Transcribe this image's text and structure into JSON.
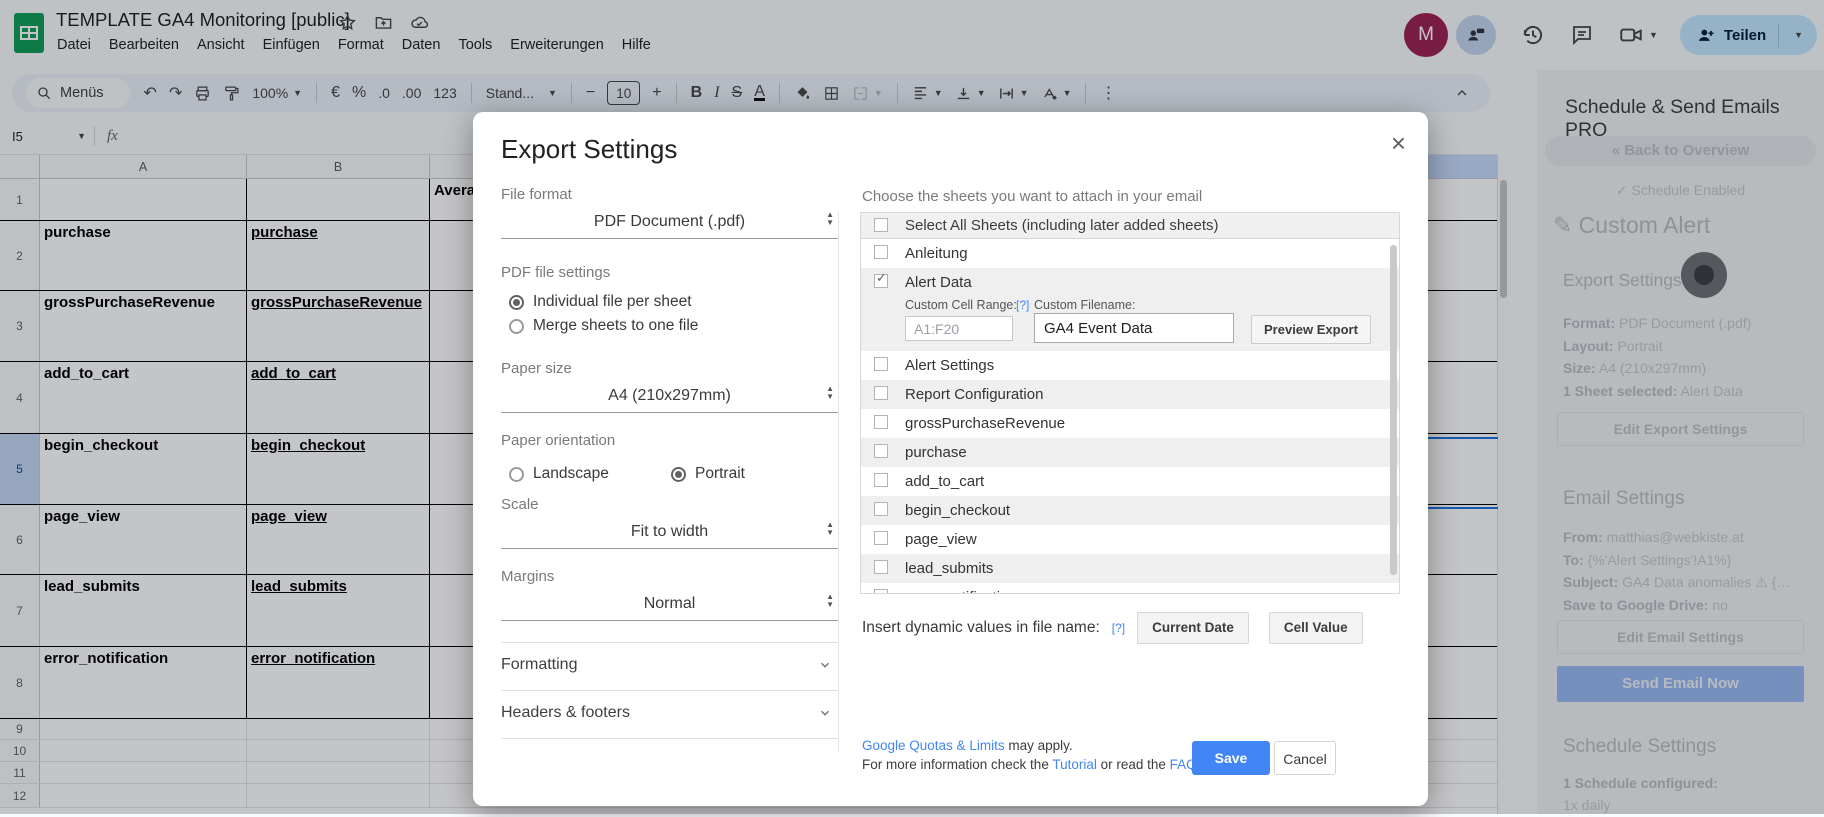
{
  "titlebar": {
    "doc_title": "TEMPLATE GA4 Monitoring [public]",
    "menus": [
      "Datei",
      "Bearbeiten",
      "Ansicht",
      "Einfügen",
      "Format",
      "Daten",
      "Tools",
      "Erweiterungen",
      "Hilfe"
    ],
    "avatar_letter": "M",
    "share_label": "Teilen"
  },
  "toolbar": {
    "menus_label": "Menüs",
    "undo": "↶",
    "redo": "↷",
    "zoom": "100%",
    "currency": "€",
    "percent": "%",
    "dec0": ".0",
    "dec00": ".00",
    "fmt123": "123",
    "font_name": "Stand...",
    "minus": "−",
    "font_size": "10",
    "plus": "+",
    "bold": "B",
    "italic": "I",
    "strike": "S",
    "text_color": "A",
    "more": "⋮"
  },
  "formula_bar": {
    "cell_ref": "I5",
    "fx": "fx"
  },
  "grid": {
    "col_headers": [
      "A",
      "B"
    ],
    "rows": [
      {
        "n": "1",
        "a": "",
        "b": "",
        "c": "Avera"
      },
      {
        "n": "2",
        "a": "purchase",
        "b": "purchase"
      },
      {
        "n": "3",
        "a": "grossPurchaseRevenue",
        "b": "grossPurchaseRevenue"
      },
      {
        "n": "4",
        "a": "add_to_cart",
        "b": "add_to_cart"
      },
      {
        "n": "5",
        "a": "begin_checkout",
        "b": "begin_checkout"
      },
      {
        "n": "6",
        "a": "page_view",
        "b": "page_view"
      },
      {
        "n": "7",
        "a": "lead_submits",
        "b": "lead_submits"
      },
      {
        "n": "8",
        "a": "error_notification",
        "b": "error_notification"
      },
      {
        "n": "9"
      },
      {
        "n": "10"
      },
      {
        "n": "11"
      },
      {
        "n": "12"
      }
    ],
    "selection_color": "#1a73e8"
  },
  "modal": {
    "title": "Export Settings",
    "close": "×",
    "file_format": {
      "label": "File format",
      "value": "PDF Document (.pdf)"
    },
    "pdf_settings": {
      "label": "PDF file settings",
      "options": [
        {
          "label": "Individual file per sheet",
          "selected": true
        },
        {
          "label": "Merge sheets to one file",
          "selected": false
        }
      ]
    },
    "paper_size": {
      "label": "Paper size",
      "value": "A4 (210x297mm)"
    },
    "orientation": {
      "label": "Paper orientation",
      "options": [
        {
          "label": "Landscape",
          "selected": false
        },
        {
          "label": "Portrait",
          "selected": true
        }
      ]
    },
    "scale": {
      "label": "Scale",
      "value": "Fit to width"
    },
    "margins": {
      "label": "Margins",
      "value": "Normal"
    },
    "formatting_label": "Formatting",
    "headers_footers_label": "Headers & footers",
    "sheets": {
      "heading": "Choose the sheets you want to attach in your email",
      "select_all": "Select All Sheets (including later added sheets)",
      "items": [
        {
          "label": "Anleitung",
          "checked": false
        },
        {
          "label": "Alert Data",
          "checked": true,
          "expanded": true
        },
        {
          "label": "Alert Settings",
          "checked": false
        },
        {
          "label": "Report Configuration",
          "checked": false
        },
        {
          "label": "grossPurchaseRevenue",
          "checked": false
        },
        {
          "label": "purchase",
          "checked": false
        },
        {
          "label": "add_to_cart",
          "checked": false
        },
        {
          "label": "begin_checkout",
          "checked": false
        },
        {
          "label": "page_view",
          "checked": false
        },
        {
          "label": "lead_submits",
          "checked": false
        },
        {
          "label": "error_notification",
          "checked": false
        }
      ],
      "expanded": {
        "range_label": "Custom Cell Range:",
        "help": "[?]",
        "range_value": "A1:F20",
        "filename_label": "Custom Filename:",
        "filename_value": "GA4 Event Data",
        "preview_label": "Preview Export"
      }
    },
    "dynamic": {
      "label": "Insert dynamic values in file name:",
      "help": "[?]",
      "btn_date": "Current Date",
      "btn_cell": "Cell Value"
    },
    "footer": {
      "quota_link": "Google Quotas & Limits",
      "quota_rest": " may apply.",
      "info_pre": "For more information check the ",
      "tutorial_link": "Tutorial",
      "info_mid": " or read the ",
      "faqs_link": "FAQs",
      "info_end": ".",
      "save": "Save",
      "cancel": "Cancel"
    },
    "accent_color": "#4285f4"
  },
  "sidebar": {
    "title": "Schedule & Send Emails PRO",
    "back": "« Back to Overview",
    "enabled": "✓ Schedule Enabled",
    "custom_alert": "✎ Custom Alert",
    "export_heading": "Export Settings",
    "format_label": "Format:",
    "format_value": "PDF Document (.pdf)",
    "layout_label": "Layout:",
    "layout_value": "Portrait",
    "size_label": "Size:",
    "size_value": "A4 (210x297mm)",
    "sheet_label": "1 Sheet selected:",
    "sheet_value": "Alert Data",
    "edit_export": "Edit Export Settings",
    "email_heading": "Email Settings",
    "from_label": "From:",
    "from_value": "matthias@webkiste.at",
    "to_label": "To:",
    "to_value": "{%'Alert Settings'!A1%}",
    "subject_label": "Subject:",
    "subject_value": "GA4 Data anomalies ⚠ {…",
    "drive_label": "Save to Google Drive:",
    "drive_value": "no",
    "edit_email": "Edit Email Settings",
    "send_now": "Send Email Now",
    "schedule_heading": "Schedule Settings",
    "schedule_count": "1 Schedule configured:",
    "schedule_freq": "1x daily"
  }
}
